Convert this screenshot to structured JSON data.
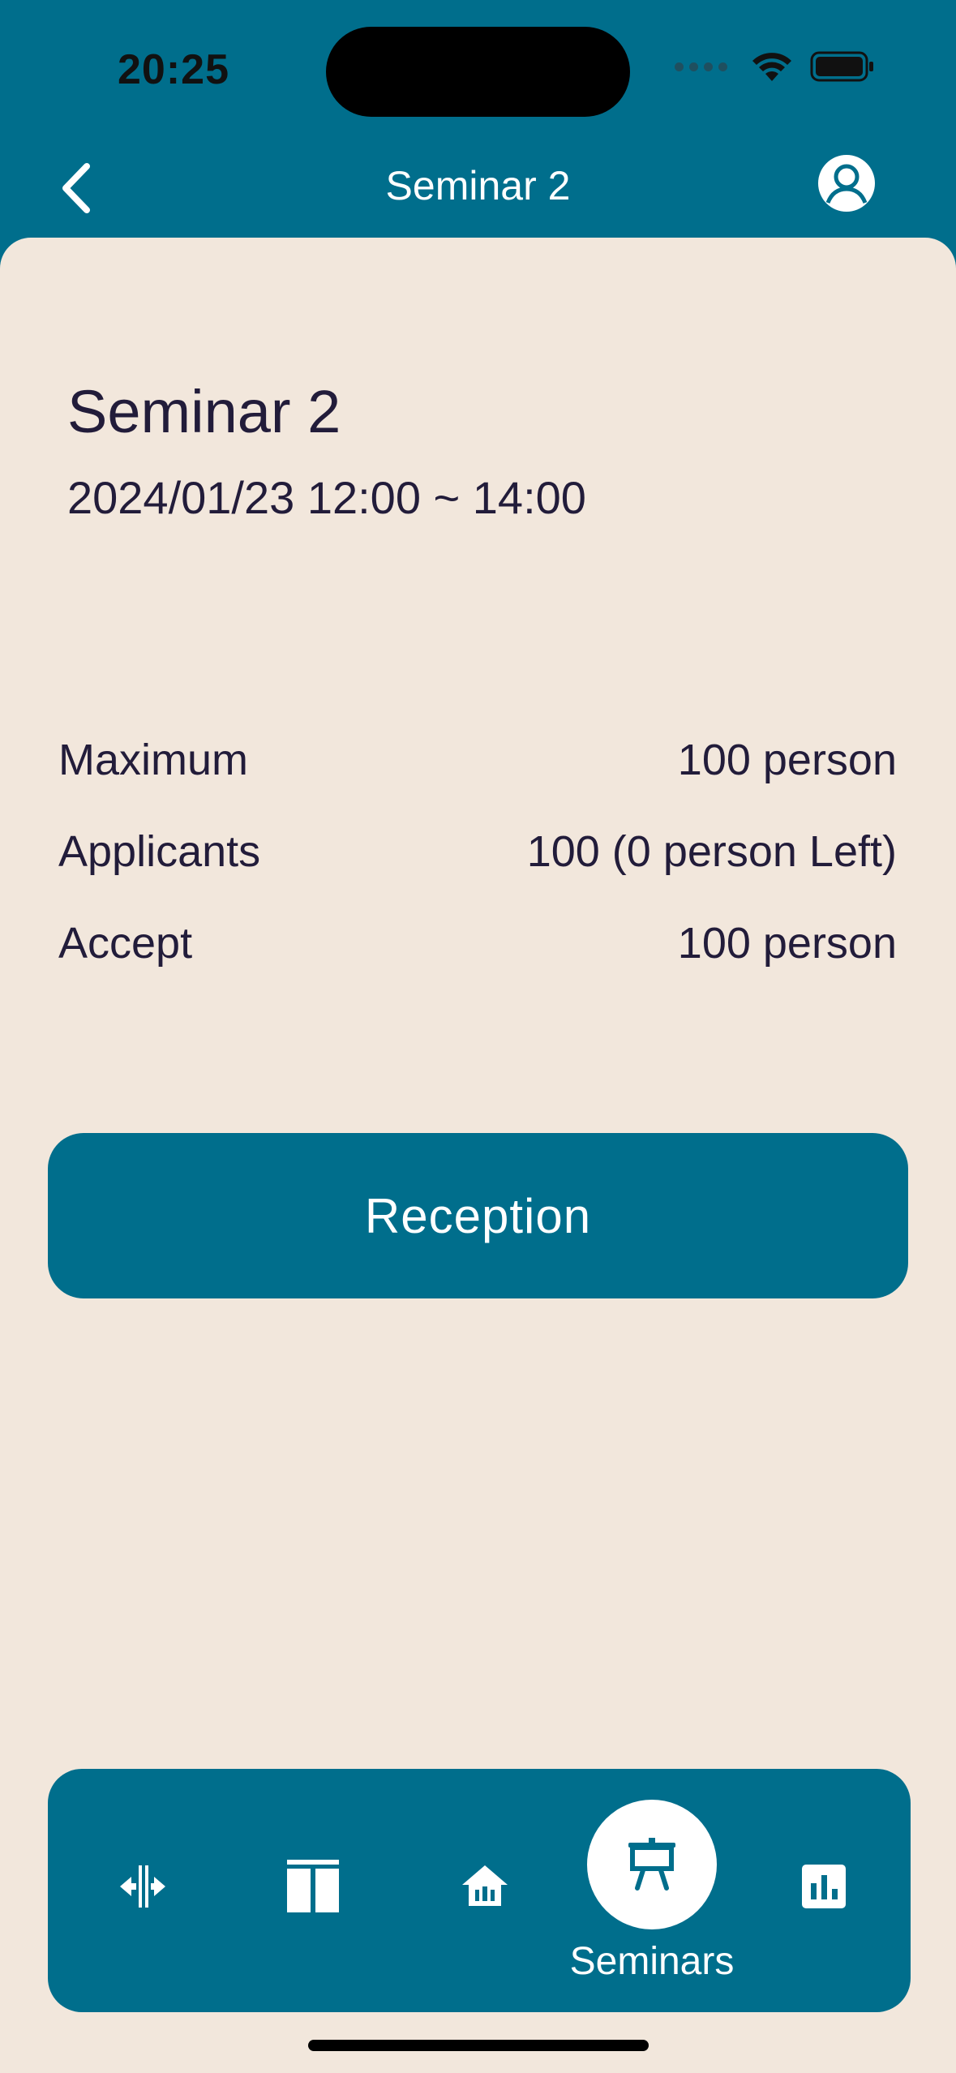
{
  "status_bar": {
    "time": "20:25"
  },
  "header": {
    "title": "Seminar 2"
  },
  "seminar": {
    "title": "Seminar 2",
    "datetime": "2024/01/23 12:00 ~ 14:00"
  },
  "details": [
    {
      "label": "Maximum",
      "value": "100 person"
    },
    {
      "label": "Applicants",
      "value": "100 (0 person Left)"
    },
    {
      "label": "Accept",
      "value": "100 person"
    }
  ],
  "actions": {
    "reception_label": "Reception"
  },
  "tab_bar": {
    "items": [
      {
        "icon": "split-icon",
        "label": ""
      },
      {
        "icon": "columns-icon",
        "label": ""
      },
      {
        "icon": "bank-icon",
        "label": ""
      },
      {
        "icon": "presentation-icon",
        "label": "Seminars",
        "active": true
      },
      {
        "icon": "bar-chart-icon",
        "label": ""
      }
    ]
  },
  "colors": {
    "primary": "#006E8C",
    "background": "#F2E7DC",
    "text": "#221C3A"
  }
}
